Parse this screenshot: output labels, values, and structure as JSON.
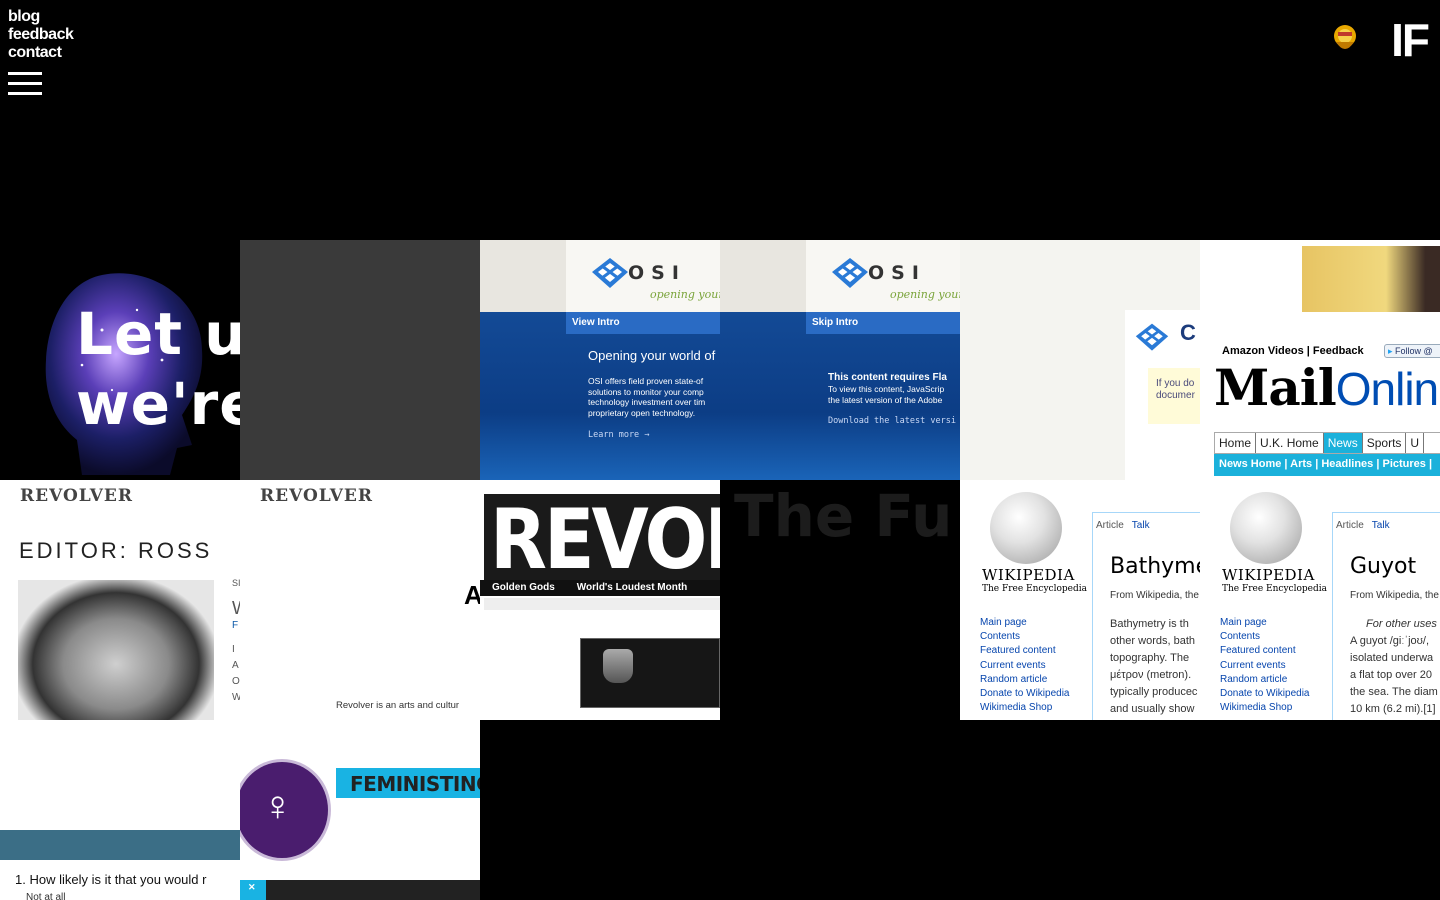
{
  "nav": {
    "blog": "blog",
    "feedback": "feedback",
    "contact": "contact"
  },
  "brand": {
    "text": "IF"
  },
  "tiles": {
    "letus": {
      "line1": "Let u",
      "line2": "we're"
    },
    "osi1": {
      "logo": "OSI",
      "tagline": "opening your",
      "bar": "View Intro",
      "heading": "Opening your world of",
      "body": [
        "OSI offers field proven state-of",
        "solutions to monitor your comp",
        "technology investment over tim",
        "proprietary open technology."
      ],
      "link": "Learn more →"
    },
    "osi2": {
      "logo": "OSI",
      "tagline": "opening your",
      "bar": "Skip Intro",
      "heading": "This content requires Fla",
      "body": [
        "To view this content, JavaScrip",
        "the latest version of the Adobe"
      ],
      "link": "Download the latest versi"
    },
    "flash": {
      "letter": "C",
      "note_line1": "If you do",
      "note_line2": "documer"
    },
    "mail": {
      "links": "Amazon Videos | Feedback",
      "follow": "Follow @",
      "mast_bold": "Mail",
      "mast_light": "Onlin",
      "nav": [
        "Home",
        "U.K. Home",
        "News",
        "Sports",
        "U"
      ],
      "subnav": "News Home | Arts | Headlines | Pictures |"
    },
    "rev1": {
      "logo": "REVOLVER",
      "editor": "EDITOR: ROSS",
      "side_top": "SI",
      "side_w": "W",
      "side_f": "F",
      "side_lines": [
        "I",
        "A",
        "O",
        "W"
      ]
    },
    "rev2": {
      "logo": "REVOLVER",
      "big_letter": "A",
      "about": "Revolver is an arts and cultur"
    },
    "rev3": {
      "big": "REVOLV",
      "sub1": "Golden Gods",
      "sub2": "World's Loudest Month"
    },
    "future": {
      "text": "The Fu"
    },
    "wiki1": {
      "wordmark": "WIKIPEDIA",
      "sub": "The Free Encyclopedia",
      "links": [
        "Main page",
        "Contents",
        "Featured content",
        "Current events",
        "Random article",
        "Donate to Wikipedia",
        "Wikimedia Shop"
      ],
      "tab_article": "Article",
      "tab_talk": "Talk",
      "title": "Bathyme",
      "from": "From Wikipedia, the",
      "body": [
        "Bathymetry is th",
        "other words, bath",
        "topography. The",
        "μέτρον (metron).",
        "typically producec",
        "and usually show"
      ]
    },
    "wiki2": {
      "wordmark": "WIKIPEDIA",
      "sub": "The Free Encyclopedia",
      "links": [
        "Main page",
        "Contents",
        "Featured content",
        "Current events",
        "Random article",
        "Donate to Wikipedia",
        "Wikimedia Shop"
      ],
      "tab_article": "Article",
      "tab_talk": "Talk",
      "title": "Guyot",
      "from": "From Wikipedia, the",
      "body": [
        "For other uses",
        "A guyot /ɡiːˈjoʊ/,",
        "isolated underwa",
        "a flat top over 20",
        "the sea. The diam",
        "10 km (6.2 mi).[1]"
      ]
    },
    "survey": {
      "question": "1. How likely is it that you would r",
      "option": "Not at all"
    },
    "feministing": {
      "name": "FEMINISTING"
    }
  }
}
